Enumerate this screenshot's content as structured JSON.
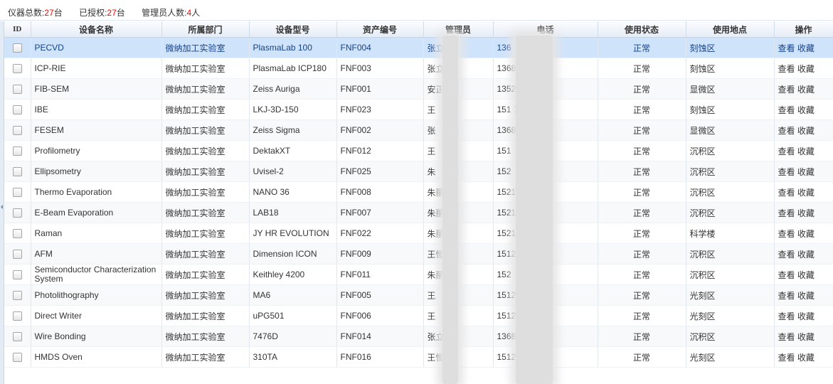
{
  "stats": [
    {
      "label": "仪器总数:",
      "value": "27",
      "unit": "台"
    },
    {
      "label": "已授权:",
      "value": "27",
      "unit": "台"
    },
    {
      "label": "管理员人数:",
      "value": "4",
      "unit": "人"
    }
  ],
  "columns": [
    "ID",
    "设备名称",
    "所属部门",
    "设备型号",
    "资产编号",
    "管理员",
    "电话",
    "使用状态",
    "使用地点",
    "操作"
  ],
  "ops": {
    "view": "查看",
    "favorite": "收藏"
  },
  "rows": [
    {
      "name": "PECVD",
      "dept": "微纳加工实验室",
      "model": "PlasmaLab 100",
      "asset": "FNF004",
      "manager": "张立",
      "phone": "136",
      "status": "正常",
      "location": "刻蚀区"
    },
    {
      "name": "ICP-RIE",
      "dept": "微纳加工实验室",
      "model": "PlasmaLab ICP180",
      "asset": "FNF003",
      "manager": "张立",
      "phone": "1368",
      "status": "正常",
      "location": "刻蚀区"
    },
    {
      "name": "FIB-SEM",
      "dept": "微纳加工实验室",
      "model": "Zeiss Auriga",
      "asset": "FNF001",
      "manager": "安正",
      "phone": "1352",
      "status": "正常",
      "location": "显微区"
    },
    {
      "name": "IBE",
      "dept": "微纳加工实验室",
      "model": "LKJ-3D-150",
      "asset": "FNF023",
      "manager": "王",
      "phone": "151                1",
      "status": "正常",
      "location": "刻蚀区"
    },
    {
      "name": "FESEM",
      "dept": "微纳加工实验室",
      "model": "Zeiss Sigma",
      "asset": "FNF002",
      "manager": "张",
      "phone": "1368",
      "status": "正常",
      "location": "显微区"
    },
    {
      "name": "Profilometry",
      "dept": "微纳加工实验室",
      "model": "DektakXT",
      "asset": "FNF012",
      "manager": "王",
      "phone": "151",
      "status": "正常",
      "location": "沉积区"
    },
    {
      "name": "Ellipsometry",
      "dept": "微纳加工实验室",
      "model": "Uvisel-2",
      "asset": "FNF025",
      "manager": "朱",
      "phone": "152",
      "status": "正常",
      "location": "沉积区"
    },
    {
      "name": "Thermo Evaporation",
      "dept": "微纳加工实验室",
      "model": "NANO 36",
      "asset": "FNF008",
      "manager": "朱丽",
      "phone": "1521",
      "status": "正常",
      "location": "沉积区"
    },
    {
      "name": "E-Beam Evaporation",
      "dept": "微纳加工实验室",
      "model": "LAB18",
      "asset": "FNF007",
      "manager": "朱丽",
      "phone": "15216        34",
      "status": "正常",
      "location": "沉积区"
    },
    {
      "name": "Raman",
      "dept": "微纳加工实验室",
      "model": "JY HR EVOLUTION",
      "asset": "FNF022",
      "manager": "朱丽",
      "phone": "152167      4",
      "status": "正常",
      "location": "科学楼"
    },
    {
      "name": "AFM",
      "dept": "微纳加工实验室",
      "model": "Dimension ICON",
      "asset": "FNF009",
      "manager": "王恒",
      "phone": "1512             1",
      "status": "正常",
      "location": "沉积区"
    },
    {
      "name": "Semiconductor Characterization System",
      "dept": "微纳加工实验室",
      "model": "Keithley 4200",
      "asset": "FNF011",
      "manager": "朱丽",
      "phone": "152",
      "status": "正常",
      "location": "沉积区"
    },
    {
      "name": "Photolithography",
      "dept": "微纳加工实验室",
      "model": "MA6",
      "asset": "FNF005",
      "manager": "王",
      "phone": "1512",
      "status": "正常",
      "location": "光刻区"
    },
    {
      "name": "Direct Writer",
      "dept": "微纳加工实验室",
      "model": "uPG501",
      "asset": "FNF006",
      "manager": "王",
      "phone": "1512",
      "status": "正常",
      "location": "光刻区"
    },
    {
      "name": "Wire Bonding",
      "dept": "微纳加工实验室",
      "model": "7476D",
      "asset": "FNF014",
      "manager": "张立",
      "phone": "13681            9",
      "status": "正常",
      "location": "沉积区"
    },
    {
      "name": "HMDS Oven",
      "dept": "微纳加工实验室",
      "model": "310TA",
      "asset": "FNF016",
      "manager": "王恒",
      "phone": "15121",
      "status": "正常",
      "location": "光刻区"
    }
  ]
}
